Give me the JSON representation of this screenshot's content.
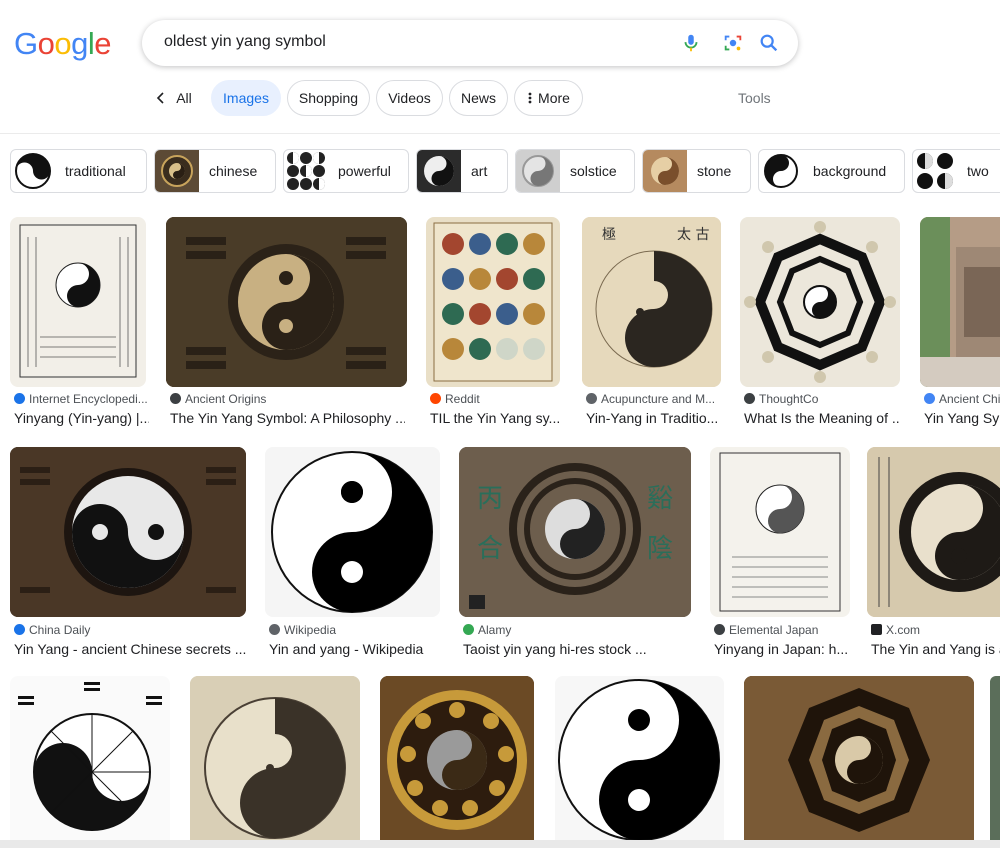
{
  "logo": {
    "letters": [
      "G",
      "o",
      "o",
      "g",
      "l",
      "e"
    ],
    "colors": [
      "#4285f4",
      "#ea4335",
      "#fbbc05",
      "#4285f4",
      "#34a853",
      "#ea4335"
    ]
  },
  "search": {
    "query": "oldest yin yang symbol"
  },
  "tabs": [
    {
      "label": "All",
      "active": false
    },
    {
      "label": "Images",
      "active": true
    },
    {
      "label": "Shopping",
      "active": false
    },
    {
      "label": "Videos",
      "active": false
    },
    {
      "label": "News",
      "active": false
    },
    {
      "label": "More",
      "active": false
    }
  ],
  "tools_label": "Tools",
  "chips": [
    "traditional",
    "chinese",
    "powerful",
    "art",
    "solstice",
    "stone",
    "background",
    "two"
  ],
  "results": [
    {
      "source": "Internet Encyclopedi...",
      "title": "Yinyang (Yin-yang) |...",
      "src_color": "#1a73e8"
    },
    {
      "source": "Ancient Origins",
      "title": "The Yin Yang Symbol: A Philosophy ...",
      "src_color": "#3c4043"
    },
    {
      "source": "Reddit",
      "title": "TIL the Yin Yang sy...",
      "src_color": "#ff4500"
    },
    {
      "source": "Acupuncture and M...",
      "title": "Yin-Yang in Traditio...",
      "src_color": "#5f6368"
    },
    {
      "source": "ThoughtCo",
      "title": "What Is the Meaning of ...",
      "src_color": "#3c4043"
    },
    {
      "source": "Ancient Chi",
      "title": "Yin Yang Syn",
      "src_color": "#4285f4"
    },
    {
      "source": "China Daily",
      "title": "Yin Yang - ancient Chinese secrets ...",
      "src_color": "#1a73e8"
    },
    {
      "source": "Wikipedia",
      "title": "Yin and yang - Wikipedia",
      "src_color": "#5f6368"
    },
    {
      "source": "Alamy",
      "title": "Taoist yin yang hi-res stock ...",
      "src_color": "#34a853"
    },
    {
      "source": "Elemental Japan",
      "title": "Yinyang in Japan: h...",
      "src_color": "#3c4043"
    },
    {
      "source": "X.com",
      "title": "The Yin and Yang is a",
      "src_color": "#202124"
    }
  ]
}
